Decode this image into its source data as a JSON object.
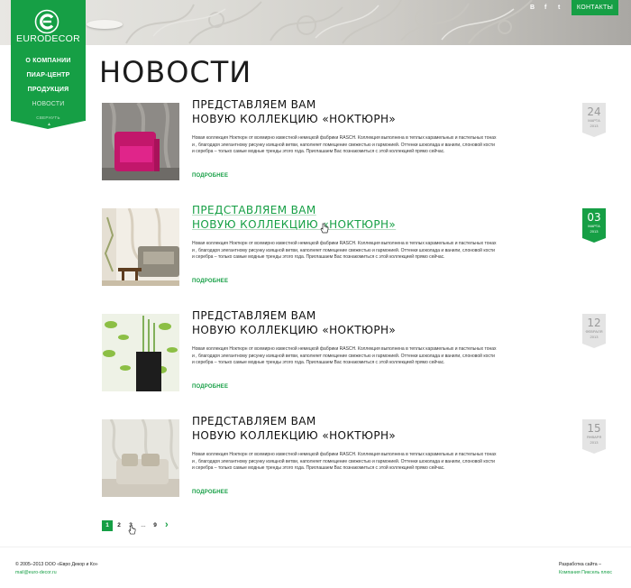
{
  "brand": {
    "name": "EURODECOR",
    "accent": "#169f45"
  },
  "nav": {
    "items": [
      {
        "label": "О компании",
        "active": false
      },
      {
        "label": "Пиар-центр",
        "active": false
      },
      {
        "label": "Продукция",
        "active": false
      },
      {
        "label": "Новости",
        "active": true
      }
    ],
    "collapse_label": "СВЕРНУТЬ"
  },
  "header": {
    "social": [
      {
        "label": "В",
        "icon": "vk-icon"
      },
      {
        "label": "f",
        "icon": "facebook-icon"
      },
      {
        "label": "t",
        "icon": "twitter-icon"
      }
    ],
    "contacts_label": "КОНТАКТЫ"
  },
  "page": {
    "title": "НОВОСТИ"
  },
  "news": [
    {
      "title_line1": "ПРЕДСТАВЛЯЕМ ВАМ",
      "title_line2": "НОВУЮ КОЛЛЕКЦИЮ «НОКТЮРН»",
      "text": "Новая коллекция Ноктюрн от всемирно известной немецкой фабрики RASCH. Коллекция выполнена в теплых карамельных и пастельных тонах и , благодаря элегантному рисунку изящной ветви, наполняет помещение свежестью и гармонией. Оттенки шоколада и ванили, слоновой кости и серебра – только самые модные тренды этого года. Приглашаем Вас познакомиться с этой коллекцией прямо сейчас.",
      "more": "ПОДРОБНЕЕ",
      "day": "24",
      "month": "МАРТА",
      "year": "2013",
      "highlighted": false
    },
    {
      "title_line1": "ПРЕДСТАВЛЯЕМ ВАМ",
      "title_line2": "НОВУЮ КОЛЛЕКЦИЮ «НОКТЮРН»",
      "text": "Новая коллекция Ноктюрн от всемирно известной немецкой фабрики RASCH. Коллекция выполнена в теплых карамельных и пастельных тонах и , благодаря элегантному рисунку изящной ветви, наполняет помещение свежестью и гармонией. Оттенки шоколада и ванили, слоновой кости и серебра – только самые модные тренды этого года. Приглашаем Вас познакомиться с этой коллекцией прямо сейчас.",
      "more": "ПОДРОБНЕЕ",
      "day": "03",
      "month": "МАРТА",
      "year": "2013",
      "highlighted": true
    },
    {
      "title_line1": "ПРЕДСТАВЛЯЕМ ВАМ",
      "title_line2": "НОВУЮ КОЛЛЕКЦИЮ «НОКТЮРН»",
      "text": "Новая коллекция Ноктюрн от всемирно известной немецкой фабрики RASCH. Коллекция выполнена в теплых карамельных и пастельных тонах и , благодаря элегантному рисунку изящной ветви, наполняет помещение свежестью и гармонией. Оттенки шоколада и ванили, слоновой кости и серебра – только самые модные тренды этого года. Приглашаем Вас познакомиться с этой коллекцией прямо сейчас.",
      "more": "ПОДРОБНЕЕ",
      "day": "12",
      "month": "ФЕВРАЛЯ",
      "year": "2013",
      "highlighted": false
    },
    {
      "title_line1": "ПРЕДСТАВЛЯЕМ ВАМ",
      "title_line2": "НОВУЮ КОЛЛЕКЦИЮ «НОКТЮРН»",
      "text": "Новая коллекция Ноктюрн от всемирно известной немецкой фабрики RASCH. Коллекция выполнена в теплых карамельных и пастельных тонах и , благодаря элегантному рисунку изящной ветви, наполняет помещение свежестью и гармонией. Оттенки шоколада и ванили, слоновой кости и серебра – только самые модные тренды этого года. Приглашаем Вас познакомиться с этой коллекцией прямо сейчас.",
      "more": "ПОДРОБНЕЕ",
      "day": "15",
      "month": "ЯНВАРЯ",
      "year": "2013",
      "highlighted": false
    }
  ],
  "pagination": {
    "pages": [
      "1",
      "2",
      "3",
      "...",
      "9"
    ],
    "current": "1",
    "next_icon": "chevron-right-icon"
  },
  "footer": {
    "copyright": "© 2005–2013 ООО «Евро Декор и Ко»",
    "email": "mail@euro-decor.ru",
    "dev_label": "Разработка сайта –",
    "dev_company": "Компания Пиксель плюс"
  }
}
